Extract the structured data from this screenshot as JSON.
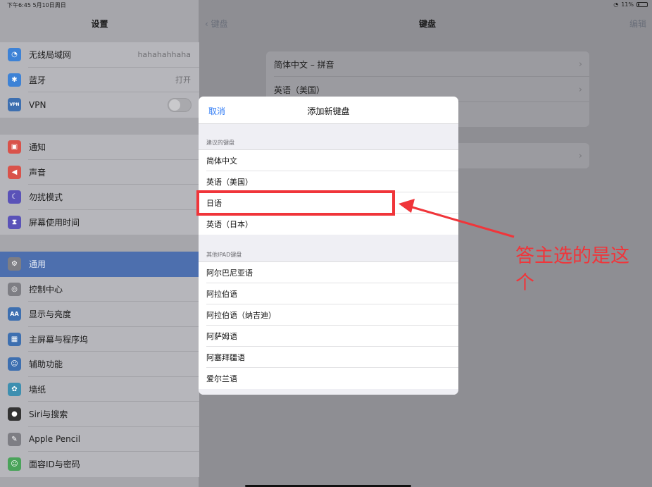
{
  "status_bar": {
    "time": "下午6:45  5月10日周日",
    "battery": "11%"
  },
  "sidebar": {
    "title": "设置",
    "group1": [
      {
        "icon": "wifi-icon",
        "glyph": "◔",
        "color": "#3d82d6",
        "label": "无线局域网",
        "value": "hahahahhaha"
      },
      {
        "icon": "bluetooth-icon",
        "glyph": "✱",
        "color": "#3d82d6",
        "label": "蓝牙",
        "value": "打开"
      },
      {
        "icon": "vpn-icon",
        "glyph": "VPN",
        "color": "#3d6fb0",
        "label": "VPN",
        "value": ""
      }
    ],
    "group2": [
      {
        "icon": "notifications-icon",
        "glyph": "▣",
        "color": "#d9524a",
        "label": "通知"
      },
      {
        "icon": "sounds-icon",
        "glyph": "◀",
        "color": "#d9524a",
        "label": "声音"
      },
      {
        "icon": "do-not-disturb-icon",
        "glyph": "☾",
        "color": "#5a52b8",
        "label": "勿扰模式"
      },
      {
        "icon": "screen-time-icon",
        "glyph": "⧗",
        "color": "#5a52b8",
        "label": "屏幕使用时间"
      }
    ],
    "group3": [
      {
        "icon": "gear-icon",
        "glyph": "⚙",
        "color": "#7e7e84",
        "label": "通用",
        "selected": true
      },
      {
        "icon": "control-center-icon",
        "glyph": "◎",
        "color": "#7e7e84",
        "label": "控制中心"
      },
      {
        "icon": "display-icon",
        "glyph": "AA",
        "color": "#3d6fb0",
        "label": "显示与亮度"
      },
      {
        "icon": "home-screen-icon",
        "glyph": "▦",
        "color": "#3d6fb0",
        "label": "主屏幕与程序坞"
      },
      {
        "icon": "accessibility-icon",
        "glyph": "☺",
        "color": "#3d6fb0",
        "label": "辅助功能"
      },
      {
        "icon": "wallpaper-icon",
        "glyph": "✿",
        "color": "#3d8fb0",
        "label": "墙纸"
      },
      {
        "icon": "siri-icon",
        "glyph": "●",
        "color": "#333",
        "label": "Siri与搜索"
      },
      {
        "icon": "apple-pencil-icon",
        "glyph": "✎",
        "color": "#7e7e84",
        "label": "Apple Pencil"
      },
      {
        "icon": "face-id-icon",
        "glyph": "☺",
        "color": "#4aa35a",
        "label": "面容ID与密码"
      }
    ]
  },
  "main": {
    "back_label": "键盘",
    "title": "键盘",
    "edit_label": "编辑",
    "rows": [
      "简体中文 – 拼音",
      "英语（美国）"
    ]
  },
  "modal": {
    "cancel_label": "取消",
    "title": "添加新键盘",
    "suggested_header": "建议的键盘",
    "suggested": [
      "简体中文",
      "英语（美国）",
      "日语",
      "英语（日本）"
    ],
    "other_header": "其他IPAD键盘",
    "other": [
      "阿尔巴尼亚语",
      "阿拉伯语",
      "阿拉伯语（纳吉迪）",
      "阿萨姆语",
      "阿塞拜疆语",
      "爱尔兰语"
    ]
  },
  "annotation": {
    "text": "答主选的是这个",
    "color": "#f0353a"
  }
}
